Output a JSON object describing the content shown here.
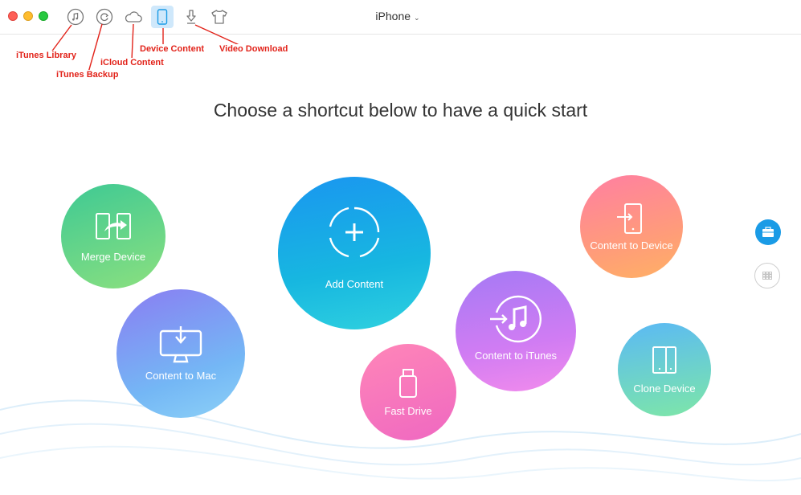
{
  "window": {
    "device_name": "iPhone"
  },
  "toolbar": {
    "items": [
      {
        "name": "iTunes Library",
        "icon": "music-note-icon"
      },
      {
        "name": "iTunes Backup",
        "icon": "backup-clock-icon"
      },
      {
        "name": "iCloud Content",
        "icon": "cloud-icon"
      },
      {
        "name": "Device Content",
        "icon": "phone-icon"
      },
      {
        "name": "Video Download",
        "icon": "download-arrow-icon"
      },
      {
        "name": "Theme",
        "icon": "tshirt-icon"
      }
    ]
  },
  "annotations": {
    "itunes_library": "iTunes Library",
    "itunes_backup": "iTunes Backup",
    "icloud_content": "iCloud Content",
    "device_content": "Device Content",
    "video_download": "Video Download"
  },
  "main": {
    "headline": "Choose a shortcut below to have a quick start",
    "shortcuts": {
      "merge_device": "Merge Device",
      "add_content": "Add Content",
      "content_to_device": "Content to Device",
      "content_to_mac": "Content to Mac",
      "content_to_itunes": "Content to iTunes",
      "fast_drive": "Fast Drive",
      "clone_device": "Clone Device"
    }
  },
  "sidebar_right": {
    "items": [
      {
        "icon": "toolbox-icon",
        "active": true
      },
      {
        "icon": "grid-icon",
        "active": false
      }
    ]
  },
  "colors": {
    "accent": "#1a9be6",
    "annotation": "#e2231a"
  }
}
